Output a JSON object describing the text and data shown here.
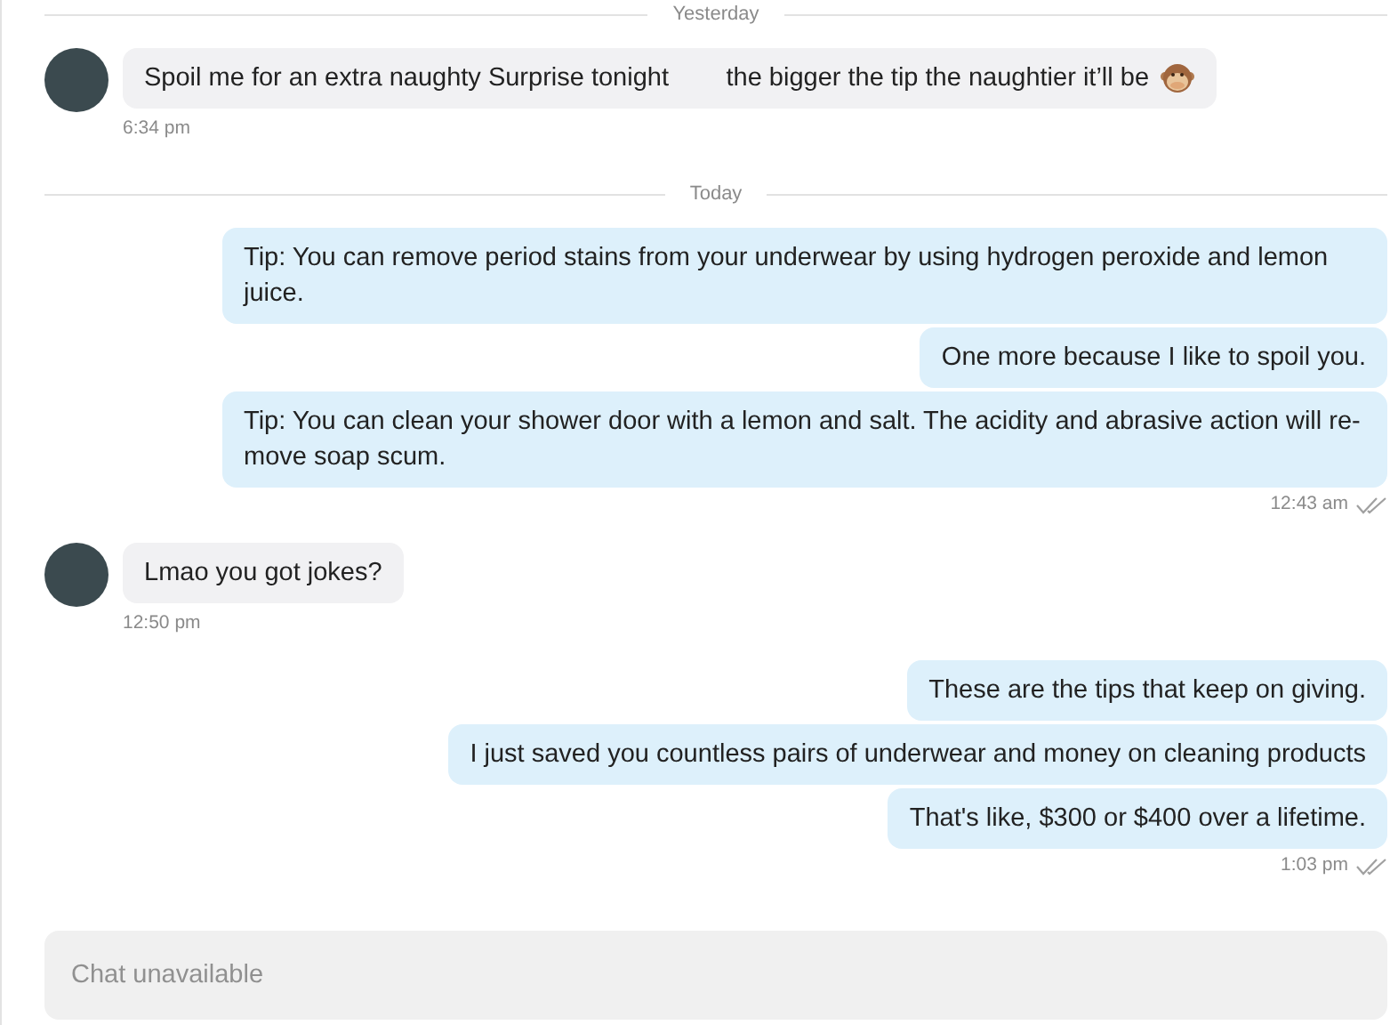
{
  "thread": [
    {
      "kind": "divider",
      "label": "Yesterday"
    },
    {
      "kind": "incoming",
      "messages": [
        {
          "text": "Spoil me for an extra naughty Surprise tonight        the bigger the tip the naughtier it’ll be",
          "emoji": true
        }
      ],
      "time": "6:34 pm"
    },
    {
      "kind": "divider",
      "label": "Today"
    },
    {
      "kind": "outgoing",
      "messages": [
        {
          "text": "Tip: You can remove period stains from your underwear by using hydrogen peroxide and lemon juice."
        },
        {
          "text": "One more because I like to spoil you."
        },
        {
          "text": "Tip: You can clean your shower door with a lemon and salt. The acidity and abrasive action will re-move soap scum."
        }
      ],
      "time": "12:43 am",
      "read": true
    },
    {
      "kind": "incoming",
      "messages": [
        {
          "text": "Lmao you got jokes?"
        }
      ],
      "time": "12:50 pm"
    },
    {
      "kind": "outgoing",
      "messages": [
        {
          "text": "These are the tips that keep on giving."
        },
        {
          "text": "I just saved you countless pairs of underwear and money on cleaning products"
        },
        {
          "text": "That's like, $300 or $400 over a lifetime."
        }
      ],
      "time": "1:03 pm",
      "read": true
    }
  ],
  "composer": {
    "placeholder": "Chat unavailable",
    "disabled": true
  }
}
